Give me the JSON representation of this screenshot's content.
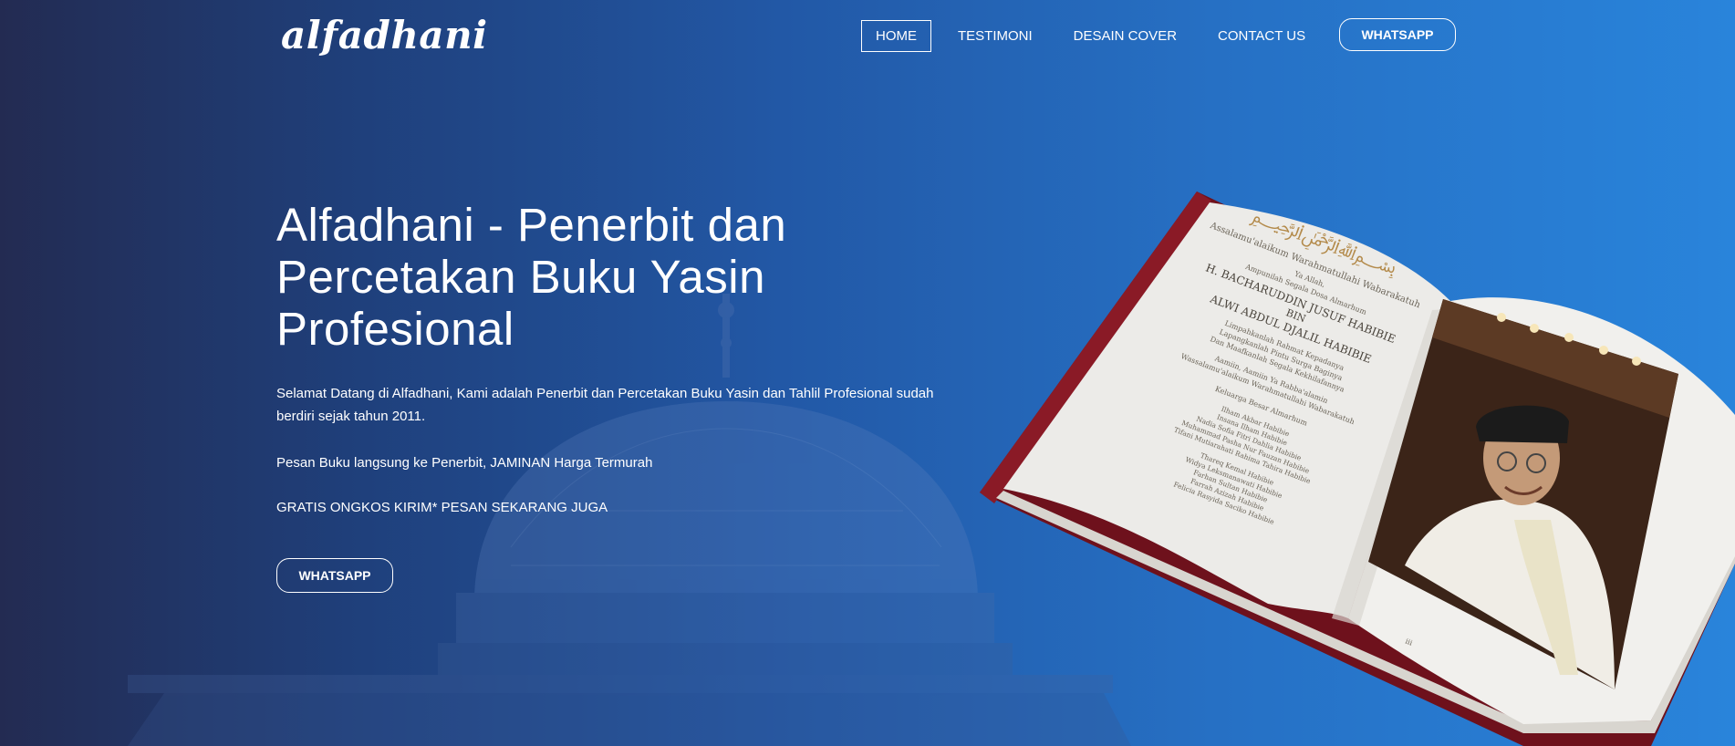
{
  "brand": {
    "logo": "alfadhani"
  },
  "nav": {
    "items": [
      {
        "label": "HOME",
        "active": true
      },
      {
        "label": "TESTIMONI",
        "active": false
      },
      {
        "label": "DESAIN COVER",
        "active": false
      },
      {
        "label": "CONTACT US",
        "active": false
      }
    ],
    "whatsapp_label": "WHATSAPP"
  },
  "hero": {
    "title": "Alfadhani - Penerbit dan Percetakan Buku Yasin Profesional",
    "paragraph1": "Selamat Datang di Alfadhani, Kami adalah Penerbit dan Percetakan Buku Yasin dan Tahlil Profesional sudah berdiri sejak tahun 2011.",
    "paragraph2": "Pesan Buku langsung ke Penerbit, JAMINAN Harga Termurah",
    "paragraph3": "GRATIS ONGKOS KIRIM* PESAN SEKARANG JUGA",
    "cta_label": "WHATSAPP"
  },
  "book_page": {
    "greeting": "Assalamu'alaikum Warahmatullahi Wabarakatuh",
    "line1": "Ya Allah,",
    "line2": "Ampunilah Segala Dosa Almarhum",
    "name1": "H. BACHARUDDIN JUSUF HABIBIE",
    "bin": "BIN",
    "name2": "ALWI ABDUL DJALIL HABIBIE",
    "prayer1": "Limpahkanlah Rahmat Kepadanya",
    "prayer2": "Lapangkanlah Pintu Surga Baginya",
    "prayer3": "Dan Maafkanlah Segala Kekhilafannya",
    "amin": "Aamiin, Aamiin Ya Rabba'alamin",
    "closing": "Wassalamu'alaikum Warahmatullahi Wabarakatuh",
    "family": "Keluarga Besar Almarhum",
    "members": [
      "Ilham Akbar Habibie",
      "Insana Ilham Habibie",
      "Nadia Sofia Fitri Dahlia Habibie",
      "Muhammad Pasha Nur Fauzan Habibie",
      "Tifani Mutiarahati Rahima Tahira Habibie",
      "Thareq Kemal Habibie",
      "Widya Leksmanawati Habibie",
      "Farhan Sultan Habibie",
      "Farrah Azizah Habibie",
      "Felicia Rasyida Saciko Habibie"
    ],
    "page_number": "iii"
  },
  "colors": {
    "bg_left": "#232b52",
    "bg_right": "#2984db",
    "book_cover": "#7a1420",
    "page": "#ecebe8"
  }
}
